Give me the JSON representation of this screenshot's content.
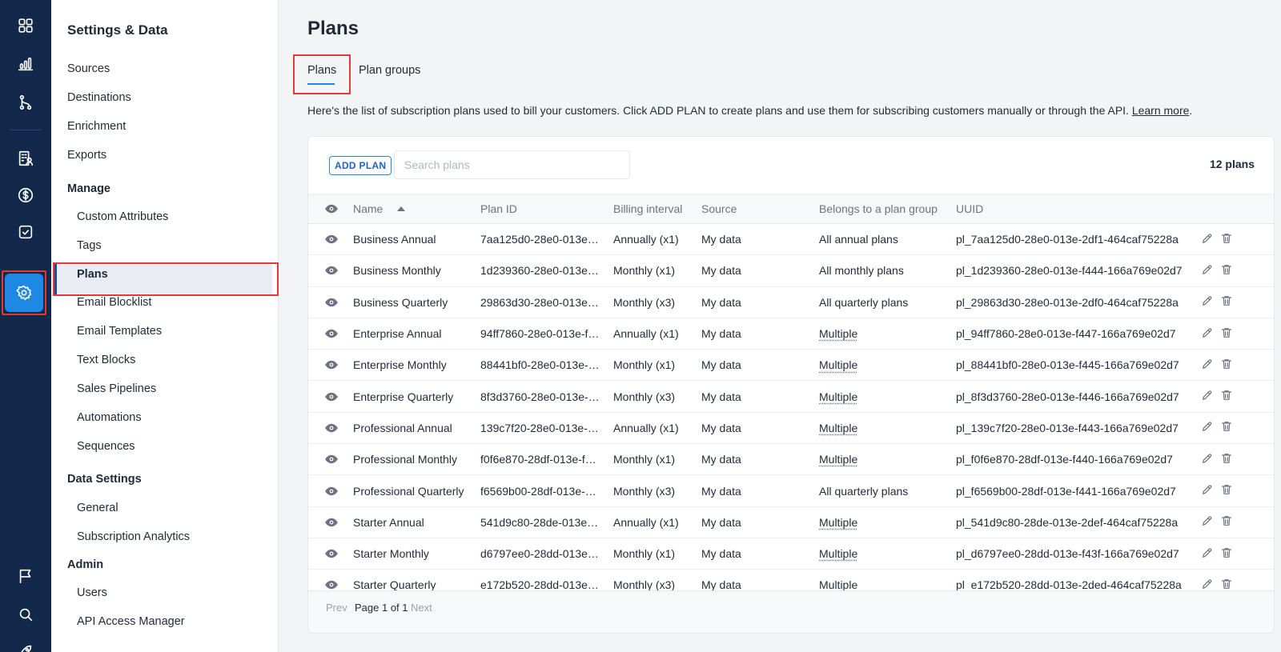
{
  "rail": {
    "items": [
      "dashboard-icon",
      "analytics-icon",
      "pipelines-icon",
      "customers-icon",
      "billing-icon",
      "tasks-icon",
      "settings-icon",
      "flag-icon",
      "search-icon",
      "rocket-icon"
    ],
    "active": "settings-icon"
  },
  "sidebar": {
    "title": "Settings & Data",
    "top_items": [
      "Sources",
      "Destinations",
      "Enrichment",
      "Exports"
    ],
    "manage_label": "Manage",
    "manage_items": [
      "Custom Attributes",
      "Tags",
      "Plans",
      "Email Blocklist",
      "Email Templates",
      "Text Blocks",
      "Sales Pipelines",
      "Automations",
      "Sequences"
    ],
    "data_settings_label": "Data Settings",
    "data_settings_items": [
      "General",
      "Subscription Analytics"
    ],
    "admin_label": "Admin",
    "admin_items": [
      "Users",
      "API Access Manager"
    ],
    "selected": "Plans"
  },
  "page": {
    "title": "Plans",
    "tabs": [
      "Plans",
      "Plan groups"
    ],
    "active_tab": "Plans",
    "intro_text": "Here's the list of subscription plans used to bill your customers. Click ADD PLAN to create plans and use them for subscribing customers manually or through the API. ",
    "learn_more": "Learn more",
    "intro_end": "."
  },
  "toolbar": {
    "add_plan": "ADD PLAN",
    "search_placeholder": "Search plans",
    "count": "12 plans"
  },
  "table": {
    "columns": [
      "Name",
      "Plan ID",
      "Billing interval",
      "Source",
      "Belongs to a plan group",
      "UUID"
    ],
    "rows": [
      {
        "name": "Business Annual",
        "plan_id": "7aa125d0-28e0-013e…",
        "interval": "Annually (x1)",
        "source": "My data",
        "group": "All annual plans",
        "group_multiple": false,
        "uuid": "pl_7aa125d0-28e0-013e-2df1-464caf75228a"
      },
      {
        "name": "Business Monthly",
        "plan_id": "1d239360-28e0-013e…",
        "interval": "Monthly (x1)",
        "source": "My data",
        "group": "All monthly plans",
        "group_multiple": false,
        "uuid": "pl_1d239360-28e0-013e-f444-166a769e02d7"
      },
      {
        "name": "Business Quarterly",
        "plan_id": "29863d30-28e0-013e…",
        "interval": "Monthly (x3)",
        "source": "My data",
        "group": "All quarterly plans",
        "group_multiple": false,
        "uuid": "pl_29863d30-28e0-013e-2df0-464caf75228a"
      },
      {
        "name": "Enterprise Annual",
        "plan_id": "94ff7860-28e0-013e-f…",
        "interval": "Annually (x1)",
        "source": "My data",
        "group": "Multiple",
        "group_multiple": true,
        "uuid": "pl_94ff7860-28e0-013e-f447-166a769e02d7"
      },
      {
        "name": "Enterprise Monthly",
        "plan_id": "88441bf0-28e0-013e-…",
        "interval": "Monthly (x1)",
        "source": "My data",
        "group": "Multiple",
        "group_multiple": true,
        "uuid": "pl_88441bf0-28e0-013e-f445-166a769e02d7"
      },
      {
        "name": "Enterprise Quarterly",
        "plan_id": "8f3d3760-28e0-013e-…",
        "interval": "Monthly (x3)",
        "source": "My data",
        "group": "Multiple",
        "group_multiple": true,
        "uuid": "pl_8f3d3760-28e0-013e-f446-166a769e02d7"
      },
      {
        "name": "Professional Annual",
        "plan_id": "139c7f20-28e0-013e-…",
        "interval": "Annually (x1)",
        "source": "My data",
        "group": "Multiple",
        "group_multiple": true,
        "uuid": "pl_139c7f20-28e0-013e-f443-166a769e02d7"
      },
      {
        "name": "Professional Monthly",
        "plan_id": "f0f6e870-28df-013e-f…",
        "interval": "Monthly (x1)",
        "source": "My data",
        "group": "Multiple",
        "group_multiple": true,
        "uuid": "pl_f0f6e870-28df-013e-f440-166a769e02d7"
      },
      {
        "name": "Professional Quarterly",
        "plan_id": "f6569b00-28df-013e-…",
        "interval": "Monthly (x3)",
        "source": "My data",
        "group": "All quarterly plans",
        "group_multiple": false,
        "uuid": "pl_f6569b00-28df-013e-f441-166a769e02d7"
      },
      {
        "name": "Starter Annual",
        "plan_id": "541d9c80-28de-013e…",
        "interval": "Annually (x1)",
        "source": "My data",
        "group": "Multiple",
        "group_multiple": true,
        "uuid": "pl_541d9c80-28de-013e-2def-464caf75228a"
      },
      {
        "name": "Starter Monthly",
        "plan_id": "d6797ee0-28dd-013e…",
        "interval": "Monthly (x1)",
        "source": "My data",
        "group": "Multiple",
        "group_multiple": true,
        "uuid": "pl_d6797ee0-28dd-013e-f43f-166a769e02d7"
      },
      {
        "name": "Starter Quarterly",
        "plan_id": "e172b520-28dd-013e…",
        "interval": "Monthly (x3)",
        "source": "My data",
        "group": "Multiple",
        "group_multiple": true,
        "uuid": "pl_e172b520-28dd-013e-2ded-464caf75228a"
      }
    ]
  },
  "pager": {
    "prev": "Prev",
    "current": "Page 1 of 1",
    "next": "Next"
  },
  "colors": {
    "rail_bg": "#13294b",
    "accent": "#1e88e5",
    "highlight_frame": "#e53935"
  }
}
